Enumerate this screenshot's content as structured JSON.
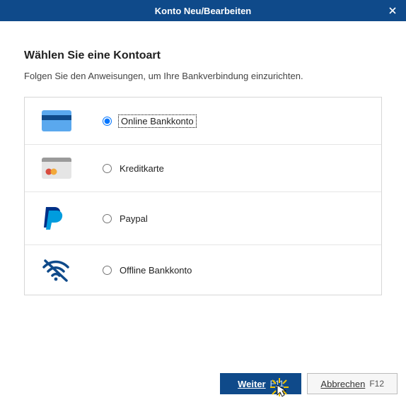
{
  "titlebar": {
    "title": "Konto Neu/Bearbeiten"
  },
  "heading": "Wählen Sie eine Kontoart",
  "subtitle": "Folgen Sie den Anweisungen, um Ihre Bankverbindung einzurichten.",
  "options": [
    {
      "label": "Online Bankkonto",
      "selected": true
    },
    {
      "label": "Kreditkarte",
      "selected": false
    },
    {
      "label": "Paypal",
      "selected": false
    },
    {
      "label": "Offline Bankkonto",
      "selected": false
    }
  ],
  "buttons": {
    "next": {
      "label": "Weiter",
      "shortcut": "F11"
    },
    "cancel": {
      "label": "Abbrechen",
      "shortcut": "F12"
    }
  }
}
